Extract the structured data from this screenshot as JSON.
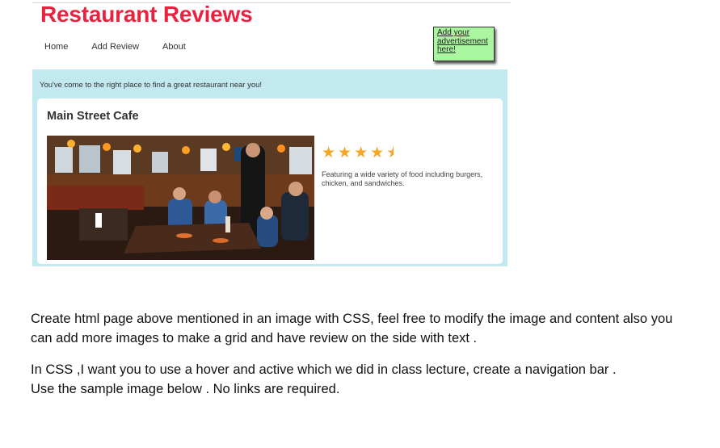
{
  "header": {
    "title": "Restaurant Reviews",
    "title_color": "#e8233f"
  },
  "nav": {
    "items": [
      {
        "label": "Home"
      },
      {
        "label": "Add Review"
      },
      {
        "label": "About"
      }
    ]
  },
  "ad": {
    "line1": "Add your",
    "line2": "advertisement",
    "line3": "here!",
    "background": "#a9f5a0"
  },
  "main": {
    "tagline": "You've come to the right place to find a great restaurant near you!",
    "panel_color": "#c2e8f0",
    "restaurant": {
      "name": "Main Street Cafe",
      "rating": 4.5,
      "rating_max": 5,
      "star_color": "#f5a623",
      "description": "Featuring a wide variety of food including burgers, chicken, and sandwiches."
    }
  },
  "instructions": {
    "p1": "Create html page above mentioned in an image with CSS, feel free to modify the image and content also you can add more images to make a grid and have review on the side with text .",
    "p2": "In CSS ,I want you to use a hover and active which we did in class lecture, create a navigation bar .",
    "p3": "Use the sample image below . No links are required."
  }
}
